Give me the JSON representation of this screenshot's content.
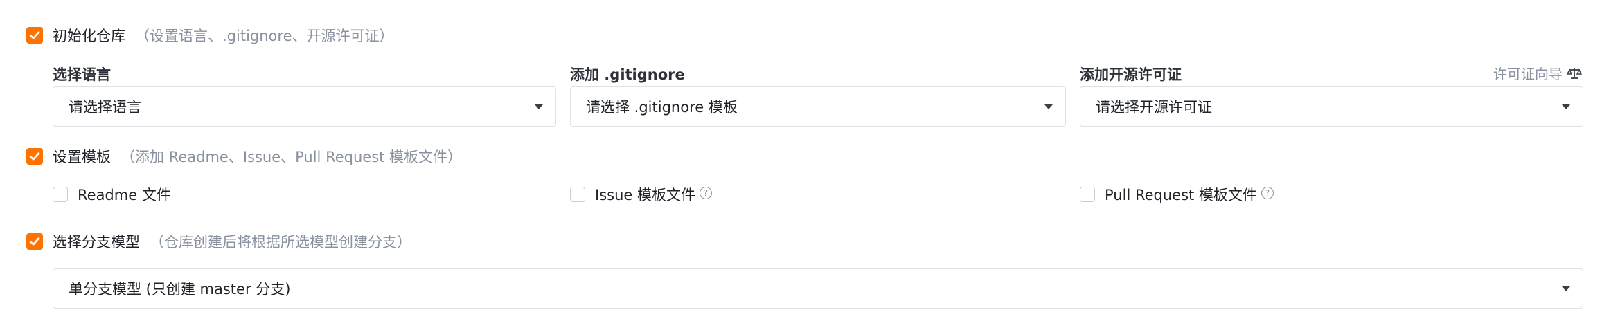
{
  "init_repo": {
    "label": "初始化仓库",
    "hint": "（设置语言、.gitignore、开源许可证）",
    "checked": true
  },
  "language": {
    "title": "选择语言",
    "placeholder": "请选择语言"
  },
  "gitignore": {
    "title": "添加 .gitignore",
    "placeholder": "请选择 .gitignore 模板"
  },
  "license": {
    "title": "添加开源许可证",
    "guide_label": "许可证向导",
    "guide_icon": "scale-icon",
    "placeholder": "请选择开源许可证"
  },
  "templates": {
    "label": "设置模板",
    "hint": "（添加 Readme、Issue、Pull Request 模板文件）",
    "checked": true,
    "options": [
      {
        "label": "Readme 文件",
        "checked": false,
        "help": false
      },
      {
        "label": "Issue 模板文件",
        "checked": false,
        "help": true
      },
      {
        "label": "Pull Request 模板文件",
        "checked": false,
        "help": true
      }
    ]
  },
  "branch_model": {
    "label": "选择分支模型",
    "hint": "（仓库创建后将根据所选模型创建分支）",
    "checked": true,
    "selected": "单分支模型 (只创建 master 分支)"
  },
  "colors": {
    "accent": "#fe7300",
    "hint_text": "#8a919f",
    "border": "#dfe1e6"
  }
}
